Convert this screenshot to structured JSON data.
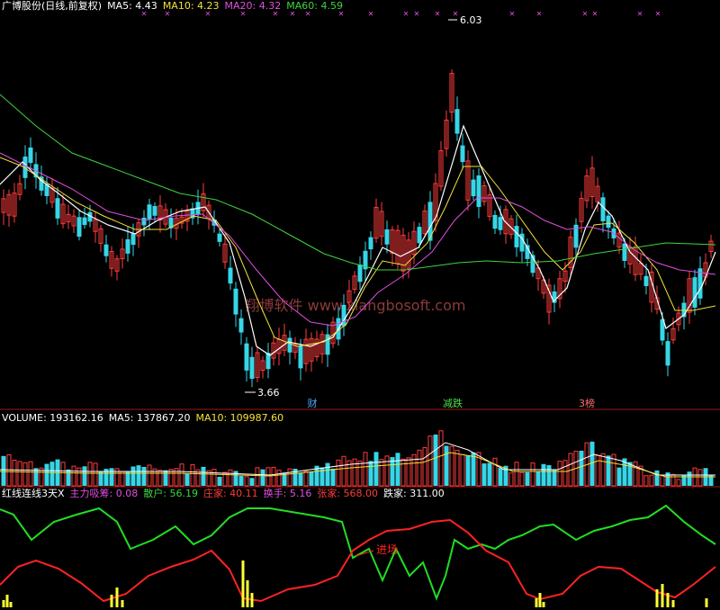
{
  "colors": {
    "background": "#000000",
    "up": "#ff3b3b",
    "down": "#36d6e7",
    "ma5": "#ffffff",
    "ma10": "#f2e03a",
    "ma20": "#e24fe0",
    "ma60": "#3ed43e",
    "green_line": "#22dd22",
    "red_line": "#ff2222",
    "yellow_bar": "#ffff33",
    "separator": "#a01818",
    "label_text": "#cfcfcf"
  },
  "header": {
    "title": "广博股份(日线,前复权)",
    "ma5": "MA5: 4.43",
    "ma10": "MA10: 4.23",
    "ma20": "MA20: 4.32",
    "ma60": "MA60: 4.59"
  },
  "watermark": "翔博软件 www.xiangbosoft.com",
  "price_panel": {
    "max_label": "6.03",
    "min_label": "3.66",
    "markers": [
      {
        "text": "财",
        "color": "#4aa8ff"
      },
      {
        "text": "减跌",
        "color": "#4be04b"
      },
      {
        "text": "3榜",
        "color": "#ff7070"
      }
    ],
    "event_glyph": "✕"
  },
  "volume_panel": {
    "volume": "VOLUME: 193162.16",
    "ma5": "MA5: 137867.20",
    "ma10": "MA10: 109987.60"
  },
  "indicator_panel": {
    "name": "红线连线3天X",
    "zhuli": "主力吸筹: 0.08",
    "sanhu": "散户: 56.19",
    "zhuangjia": "庄家: 40.11",
    "huanshou": "换手: 5.16",
    "zhangjia": "张家: 568.00",
    "diejia": "跌家: 311.00",
    "annotation": "进场"
  },
  "chart_data": {
    "type": "candlestick",
    "price_range": [
      3.6,
      6.1
    ],
    "max_value": 6.03,
    "min_value": 3.66,
    "ma_values": {
      "MA5": 4.43,
      "MA10": 4.23,
      "MA20": 4.32,
      "MA60": 4.59
    }
  }
}
